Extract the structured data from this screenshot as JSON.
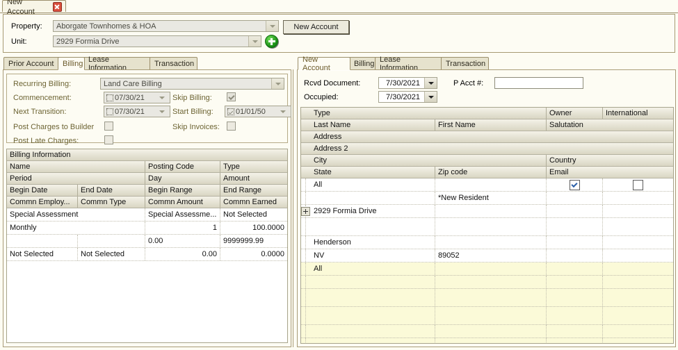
{
  "window": {
    "tab_label": "New Account",
    "close_icon": "close-icon"
  },
  "header": {
    "property_label": "Property:",
    "property_value": "Aborgate Townhomes & HOA",
    "unit_label": "Unit:",
    "unit_value": "2929 Formia Drive",
    "add_icon": "plus-circle-icon",
    "new_account_button": "New Account"
  },
  "left_panel": {
    "tabs": [
      {
        "label": "Prior Account",
        "selected": false
      },
      {
        "label": "Billing",
        "selected": true
      },
      {
        "label": "Lease Information",
        "selected": false
      },
      {
        "label": "Transaction",
        "selected": false
      }
    ],
    "fields": {
      "recurring_billing_label": "Recurring Billing:",
      "recurring_billing_value": "Land Care Billing",
      "commencement_label": "Commencement:",
      "commencement_value": "07/30/21",
      "commencement_checked": false,
      "next_transition_label": "Next Transition:",
      "next_transition_value": "07/30/21",
      "next_transition_checked": false,
      "post_charges_label": "Post Charges to Builder",
      "post_charges_checked": false,
      "post_late_label": "Post Late Charges:",
      "post_late_checked": false,
      "skip_billing_label": "Skip Billing:",
      "skip_billing_checked": true,
      "start_billing_label": "Start Billing:",
      "start_billing_value": "01/01/50",
      "start_billing_checked": true,
      "skip_invoices_label": "Skip Invoices:",
      "skip_invoices_checked": false
    },
    "grid": {
      "title": "Billing Information",
      "header_rows": [
        [
          "Name",
          "",
          "Posting Code",
          "Type"
        ],
        [
          "Period",
          "",
          "Day",
          "Amount"
        ],
        [
          "Begin Date",
          "End Date",
          "Begin Range",
          "End Range"
        ],
        [
          "Commn  Employ...",
          "Commn Type",
          "Commn Amount",
          "Commn Earned"
        ]
      ],
      "data_rows": [
        {
          "cells": [
            "Special Assessment",
            "",
            "Special  Assessme...",
            "Not Selected"
          ],
          "align": [
            "l",
            "l",
            "l",
            "l"
          ]
        },
        {
          "cells": [
            "Monthly",
            "",
            "1",
            "100.0000"
          ],
          "align": [
            "l",
            "l",
            "r",
            "r"
          ]
        },
        {
          "cells": [
            "",
            "",
            "0.00",
            "9999999.99"
          ],
          "align": [
            "l",
            "l",
            "l",
            "l"
          ]
        },
        {
          "cells": [
            "Not Selected",
            "Not Selected",
            "0.00",
            "0.0000"
          ],
          "align": [
            "l",
            "l",
            "r",
            "r"
          ]
        }
      ]
    }
  },
  "right_panel": {
    "tabs": [
      {
        "label": "New Account",
        "selected": true
      },
      {
        "label": "Billing",
        "selected": false
      },
      {
        "label": "Lease Information",
        "selected": false
      },
      {
        "label": "Transaction",
        "selected": false
      }
    ],
    "fields": {
      "rcvd_document_label": "Rcvd Document:",
      "rcvd_document_value": "7/30/2021",
      "occupied_label": "Occupied:",
      "occupied_value": "7/30/2021",
      "p_acct_label": "P Acct #:",
      "p_acct_value": ""
    },
    "grid": {
      "header_rows": [
        [
          "Type",
          "",
          "Owner",
          "International"
        ],
        [
          "Last Name",
          "First Name",
          "Salutation",
          ""
        ],
        [
          "Address",
          "",
          "",
          ""
        ],
        [
          "Address 2",
          "",
          "",
          ""
        ],
        [
          "City",
          "",
          "Country",
          ""
        ],
        [
          "State",
          "Zip code",
          "Email",
          ""
        ]
      ],
      "data_rows": [
        {
          "cells": [
            "All",
            "",
            "",
            ""
          ],
          "owner_checked": true,
          "intl_checked": false,
          "checkboxes": true,
          "yellow": false,
          "tall": false
        },
        {
          "cells": [
            "",
            "*New Resident",
            "",
            ""
          ],
          "checkboxes": false,
          "yellow": false,
          "tall": false
        },
        {
          "cells": [
            "2929 Formia Drive",
            "",
            "",
            ""
          ],
          "checkboxes": false,
          "yellow": false,
          "tall": false,
          "expand": true
        },
        {
          "cells": [
            "",
            "",
            "",
            ""
          ],
          "checkboxes": false,
          "yellow": false,
          "tall": true
        },
        {
          "cells": [
            "Henderson",
            "",
            "",
            ""
          ],
          "checkboxes": false,
          "yellow": false,
          "tall": false
        },
        {
          "cells": [
            "NV",
            "89052",
            "",
            ""
          ],
          "checkboxes": false,
          "yellow": false,
          "tall": false
        },
        {
          "cells": [
            "All",
            "",
            "",
            ""
          ],
          "checkboxes": false,
          "yellow": true,
          "tall": false
        },
        {
          "cells": [
            "",
            "",
            "",
            ""
          ],
          "checkboxes": false,
          "yellow": true,
          "tall": false
        },
        {
          "cells": [
            "",
            "",
            "",
            ""
          ],
          "checkboxes": false,
          "yellow": true,
          "tall": true
        },
        {
          "cells": [
            "",
            "",
            "",
            ""
          ],
          "checkboxes": false,
          "yellow": true,
          "tall": true
        },
        {
          "cells": [
            "",
            "",
            "",
            ""
          ],
          "checkboxes": false,
          "yellow": true,
          "tall": false
        },
        {
          "cells": [
            "",
            "",
            "",
            ""
          ],
          "checkboxes": false,
          "yellow": true,
          "tall": false
        }
      ]
    }
  },
  "colors": {
    "background": "#fdfcf3",
    "border": "#a79a74",
    "tab_selected_text": "#6b5a2a",
    "field_label_olive": "#6d6433",
    "yellow_row": "#fbfad8",
    "close_red": "#d94f3d",
    "plus_green": "#168a14",
    "check_blue": "#2a5fa8"
  }
}
